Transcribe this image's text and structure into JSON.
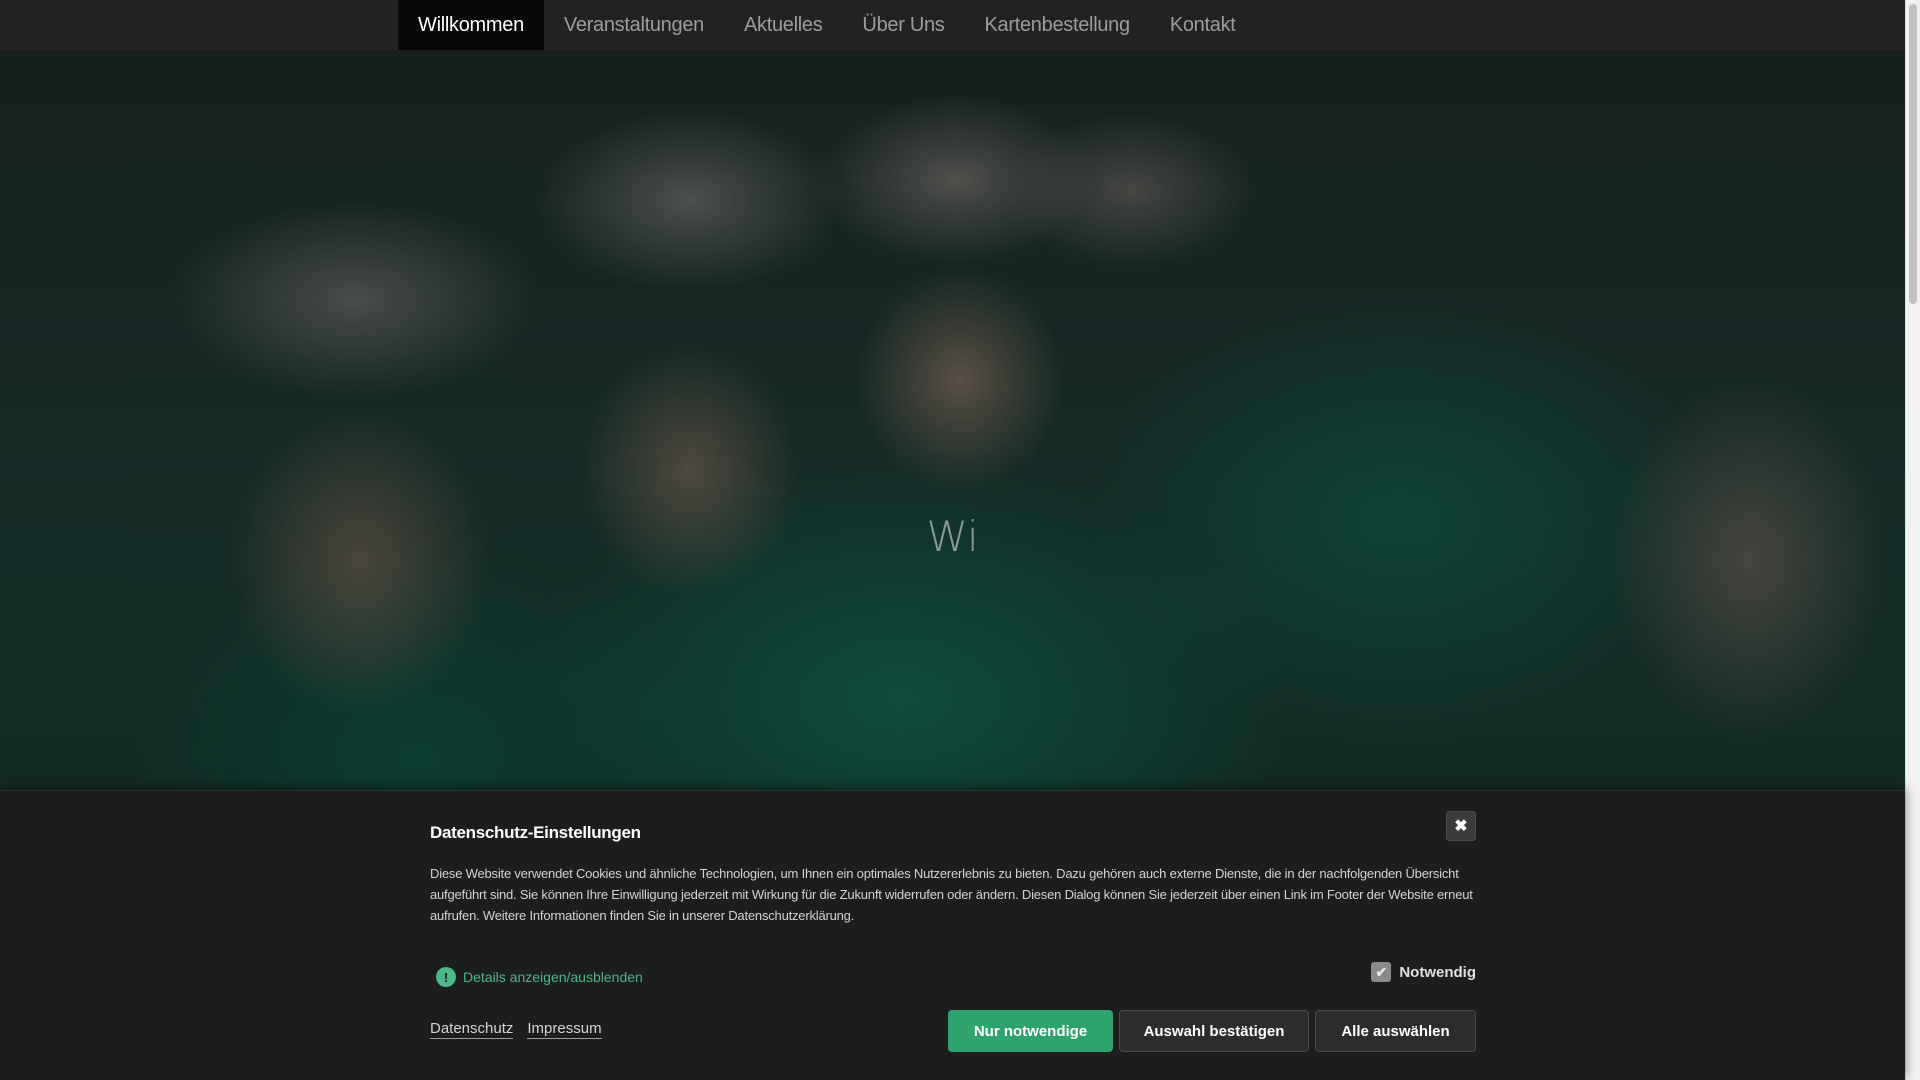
{
  "nav": {
    "items": [
      {
        "label": "Willkommen",
        "active": true
      },
      {
        "label": "Veranstaltungen",
        "active": false
      },
      {
        "label": "Aktuelles",
        "active": false
      },
      {
        "label": "Über Uns",
        "active": false
      },
      {
        "label": "Kartenbestellung",
        "active": false
      },
      {
        "label": "Kontakt",
        "active": false
      }
    ]
  },
  "hero": {
    "title": "Wi"
  },
  "cookie": {
    "title": "Datenschutz-Einstellungen",
    "close_icon": "close-icon",
    "text": "Diese Website verwendet Cookies und ähnliche Technologien, um Ihnen ein optimales Nutzererlebnis zu bieten. Dazu gehören auch externe Dienste, die in der nachfolgenden Übersicht aufgeführt sind. Sie können Ihre Einwilligung jederzeit mit Wirkung für die Zukunft widerrufen oder ändern. Diesen Dialog können Sie jederzeit über einen Link im Footer der Website erneut aufrufen. Weitere Informationen finden Sie in unserer Datenschutzerklärung.",
    "details_label": "Details anzeigen/ausblenden",
    "necessary_label": "Notwendig",
    "necessary_checked": true,
    "links": {
      "privacy": "Datenschutz",
      "imprint": "Impressum"
    },
    "buttons": {
      "only_necessary": "Nur notwendige",
      "confirm_selection": "Auswahl bestätigen",
      "select_all": "Alle auswählen"
    },
    "accent_color": "#2fa36e"
  }
}
